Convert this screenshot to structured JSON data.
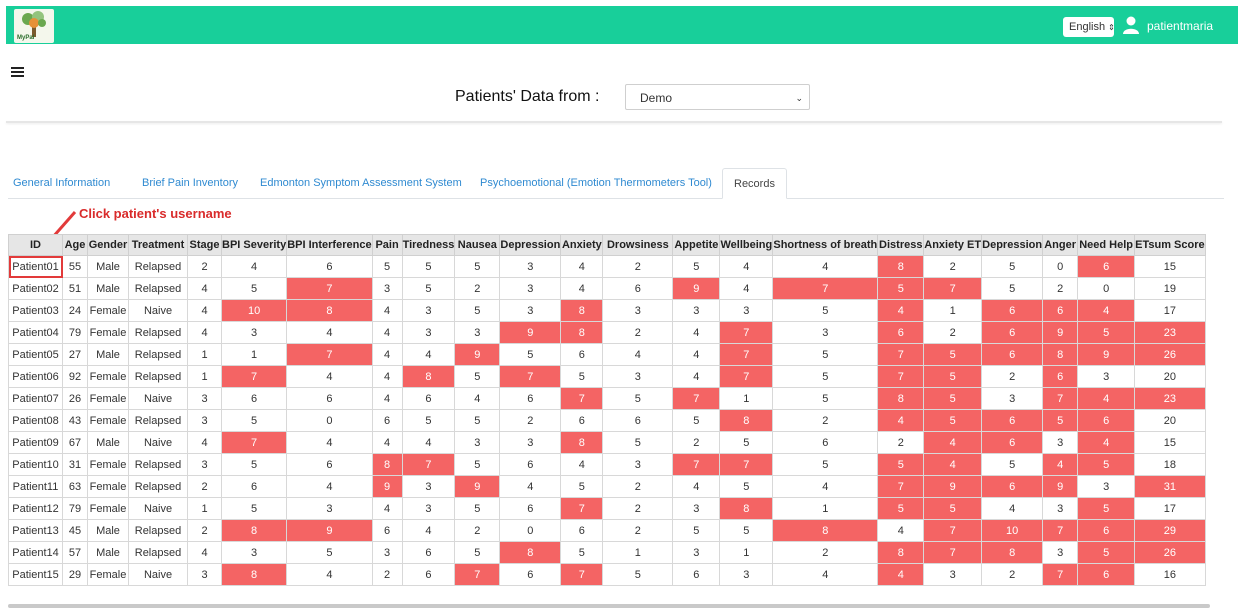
{
  "header": {
    "logo_text": "MyPal",
    "language": "English",
    "username": "patientmaria",
    "brand_color": "#18cf9a"
  },
  "page": {
    "title": "Patients' Data from :",
    "source_select_value": "Demo"
  },
  "tabs": [
    {
      "label": "General Information",
      "active": false
    },
    {
      "label": "Brief Pain Inventory",
      "active": false
    },
    {
      "label": "Edmonton Symptom Assessment System",
      "active": false
    },
    {
      "label": "Psychoemotional (Emotion Thermometers Tool)",
      "active": false
    },
    {
      "label": "Records",
      "active": true
    }
  ],
  "annotation": "Click patient's username",
  "highlight_color": "#f46464",
  "table": {
    "columns": [
      "ID",
      "Age",
      "Gender",
      "Treatment",
      "Stage",
      "BPI Severity",
      "BPI Interference",
      "Pain",
      "Tiredness",
      "Nausea",
      "Depression",
      "Anxiety",
      "Drowsiness",
      "Appetite",
      "Wellbeing",
      "Shortness of breath",
      "Distress",
      "Anxiety ET",
      "Depression",
      "Anger",
      "Need Help",
      "ETsum Score"
    ],
    "rows": [
      [
        "Patient01",
        "55",
        "Male",
        "Relapsed",
        "2",
        "4",
        "6",
        "5",
        "5",
        "5",
        "3",
        "4",
        "2",
        "5",
        "4",
        "4",
        "8",
        "2",
        "5",
        "0",
        "6",
        "15"
      ],
      [
        "Patient02",
        "51",
        "Male",
        "Relapsed",
        "4",
        "5",
        "7",
        "3",
        "5",
        "2",
        "3",
        "4",
        "6",
        "9",
        "4",
        "7",
        "5",
        "7",
        "5",
        "2",
        "0",
        "19"
      ],
      [
        "Patient03",
        "24",
        "Female",
        "Naive",
        "4",
        "10",
        "8",
        "4",
        "3",
        "5",
        "3",
        "8",
        "3",
        "3",
        "3",
        "5",
        "4",
        "1",
        "6",
        "6",
        "4",
        "17"
      ],
      [
        "Patient04",
        "79",
        "Female",
        "Relapsed",
        "4",
        "3",
        "4",
        "4",
        "3",
        "3",
        "9",
        "8",
        "2",
        "4",
        "7",
        "3",
        "6",
        "2",
        "6",
        "9",
        "5",
        "23"
      ],
      [
        "Patient05",
        "27",
        "Male",
        "Relapsed",
        "1",
        "1",
        "7",
        "4",
        "4",
        "9",
        "5",
        "6",
        "4",
        "4",
        "7",
        "5",
        "7",
        "5",
        "6",
        "8",
        "9",
        "26"
      ],
      [
        "Patient06",
        "92",
        "Female",
        "Relapsed",
        "1",
        "7",
        "4",
        "4",
        "8",
        "5",
        "7",
        "5",
        "3",
        "4",
        "7",
        "5",
        "7",
        "5",
        "2",
        "6",
        "3",
        "20"
      ],
      [
        "Patient07",
        "26",
        "Female",
        "Naive",
        "3",
        "6",
        "6",
        "4",
        "6",
        "4",
        "6",
        "7",
        "5",
        "7",
        "1",
        "5",
        "8",
        "5",
        "3",
        "7",
        "4",
        "23"
      ],
      [
        "Patient08",
        "43",
        "Female",
        "Relapsed",
        "3",
        "5",
        "0",
        "6",
        "5",
        "5",
        "2",
        "6",
        "6",
        "5",
        "8",
        "2",
        "4",
        "5",
        "6",
        "5",
        "6",
        "20"
      ],
      [
        "Patient09",
        "67",
        "Male",
        "Naive",
        "4",
        "7",
        "4",
        "4",
        "4",
        "3",
        "3",
        "8",
        "5",
        "2",
        "5",
        "6",
        "2",
        "4",
        "6",
        "3",
        "4",
        "15"
      ],
      [
        "Patient10",
        "31",
        "Female",
        "Relapsed",
        "3",
        "5",
        "6",
        "8",
        "7",
        "5",
        "6",
        "4",
        "3",
        "7",
        "7",
        "5",
        "5",
        "4",
        "5",
        "4",
        "5",
        "18"
      ],
      [
        "Patient11",
        "63",
        "Female",
        "Relapsed",
        "2",
        "6",
        "4",
        "9",
        "3",
        "9",
        "4",
        "5",
        "2",
        "4",
        "5",
        "4",
        "7",
        "9",
        "6",
        "9",
        "3",
        "31"
      ],
      [
        "Patient12",
        "79",
        "Female",
        "Naive",
        "1",
        "5",
        "3",
        "4",
        "3",
        "5",
        "6",
        "7",
        "2",
        "3",
        "8",
        "1",
        "5",
        "5",
        "4",
        "3",
        "5",
        "17"
      ],
      [
        "Patient13",
        "45",
        "Male",
        "Relapsed",
        "2",
        "8",
        "9",
        "6",
        "4",
        "2",
        "0",
        "6",
        "2",
        "5",
        "5",
        "8",
        "4",
        "7",
        "10",
        "7",
        "6",
        "29"
      ],
      [
        "Patient14",
        "57",
        "Male",
        "Relapsed",
        "4",
        "3",
        "5",
        "3",
        "6",
        "5",
        "8",
        "5",
        "1",
        "3",
        "1",
        "2",
        "8",
        "7",
        "8",
        "3",
        "5",
        "26"
      ],
      [
        "Patient15",
        "29",
        "Female",
        "Naive",
        "3",
        "8",
        "4",
        "2",
        "6",
        "7",
        "6",
        "7",
        "5",
        "6",
        "3",
        "4",
        "4",
        "3",
        "2",
        "7",
        "6",
        "16"
      ]
    ],
    "highlighted": [
      [
        16,
        20
      ],
      [
        6,
        13,
        15,
        16,
        17
      ],
      [
        5,
        6,
        11,
        16,
        18,
        19,
        20
      ],
      [
        10,
        11,
        14,
        16,
        18,
        19,
        20,
        21
      ],
      [
        6,
        9,
        14,
        16,
        17,
        18,
        19,
        20,
        21
      ],
      [
        5,
        8,
        10,
        14,
        16,
        17,
        19
      ],
      [
        11,
        13,
        16,
        17,
        19,
        20,
        21
      ],
      [
        14,
        16,
        17,
        18,
        19,
        20
      ],
      [
        5,
        11,
        17,
        18,
        20
      ],
      [
        7,
        8,
        13,
        14,
        16,
        17,
        19,
        20
      ],
      [
        7,
        9,
        16,
        17,
        18,
        19,
        21
      ],
      [
        11,
        14,
        16,
        17,
        20
      ],
      [
        5,
        6,
        15,
        17,
        18,
        19,
        20,
        21
      ],
      [
        10,
        16,
        17,
        18,
        20,
        21
      ],
      [
        5,
        9,
        11,
        16,
        19,
        20
      ]
    ]
  }
}
